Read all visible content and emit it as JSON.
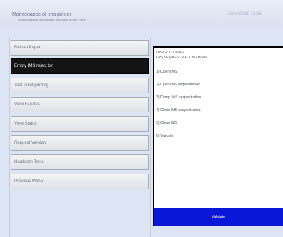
{
  "header": {
    "title": "Maintenance of Ims printer",
    "subtitle": "Which operation do you want to perform on the Printer ?",
    "datetime": "29/10/2010 13:16"
  },
  "menu": {
    "items": [
      {
        "label": "Reload Paper"
      },
      {
        "label": "Empty IMS reject bin"
      },
      {
        "label": "Test ticket printing"
      },
      {
        "label": "View Failures"
      },
      {
        "label": "View Status"
      },
      {
        "label": "Request Version"
      },
      {
        "label": "Hardware Tests"
      },
      {
        "label": "Previous Menu"
      }
    ],
    "active": "Empty IMS reject bin"
  },
  "instructions": {
    "heading": "INSTRUCTIONS",
    "subheading": "IMS SEQUESTRATION DUMP",
    "steps": [
      "1) Open IMS",
      "2) Open IMS sequestration",
      "3) Dump IMS sequestration",
      "4) Close IMS sequestration",
      "5) Close IMS",
      "6) Validate"
    ],
    "validate_label": "Validate"
  },
  "colors": {
    "background": "#dde4f3",
    "active_button": "#141414",
    "validate_button": "#0a17d8"
  }
}
